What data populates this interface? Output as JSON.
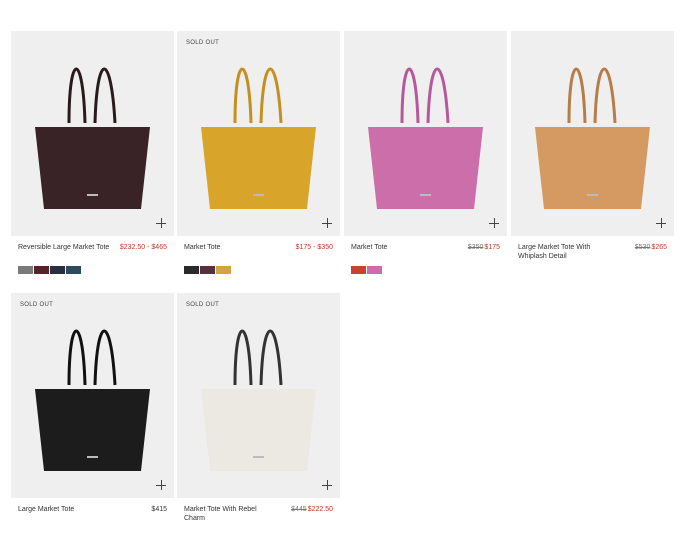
{
  "products": [
    {
      "name": "Reversible Large Market Tote",
      "badge": "",
      "price": "$232.50 - $465",
      "old_price": "",
      "price_style": "sale",
      "bag_color": "#3a2326",
      "handle_color": "#2a1a1c",
      "swatches": [
        "#7a7a7a",
        "#5a1f2a",
        "#2a2f3f",
        "#2f4a5a"
      ]
    },
    {
      "name": "Market Tote",
      "badge": "SOLD OUT",
      "price": "$175 - $350",
      "old_price": "",
      "price_style": "sale",
      "bag_color": "#d8a52a",
      "handle_color": "#c39020",
      "swatches": [
        "#2a2a2a",
        "#5a3040",
        "#d4a53a"
      ]
    },
    {
      "name": "Market Tote",
      "badge": "",
      "price": "$175",
      "old_price": "$350",
      "price_style": "sale",
      "bag_color": "#cc6ea9",
      "handle_color": "#b8579a",
      "swatches": [
        "#c8442a",
        "#cc6ea9"
      ]
    },
    {
      "name": "Large Market Tote With Whiplash Detail",
      "badge": "",
      "price": "$265",
      "old_price": "$530",
      "price_style": "sale",
      "bag_color": "#d49a62",
      "handle_color": "#b57d4a",
      "swatches": []
    },
    {
      "name": "Large Market Tote",
      "badge": "SOLD OUT",
      "price": "$415",
      "old_price": "",
      "price_style": "regular",
      "bag_color": "#1c1c1c",
      "handle_color": "#111111",
      "swatches": []
    },
    {
      "name": "Market Tote With Rebel Charm",
      "badge": "SOLD OUT",
      "price": "$222.50",
      "old_price": "$445",
      "price_style": "sale",
      "bag_color": "#ece9e2",
      "handle_color": "#333333",
      "swatches": []
    }
  ],
  "icons": {
    "add": "plus-icon"
  }
}
